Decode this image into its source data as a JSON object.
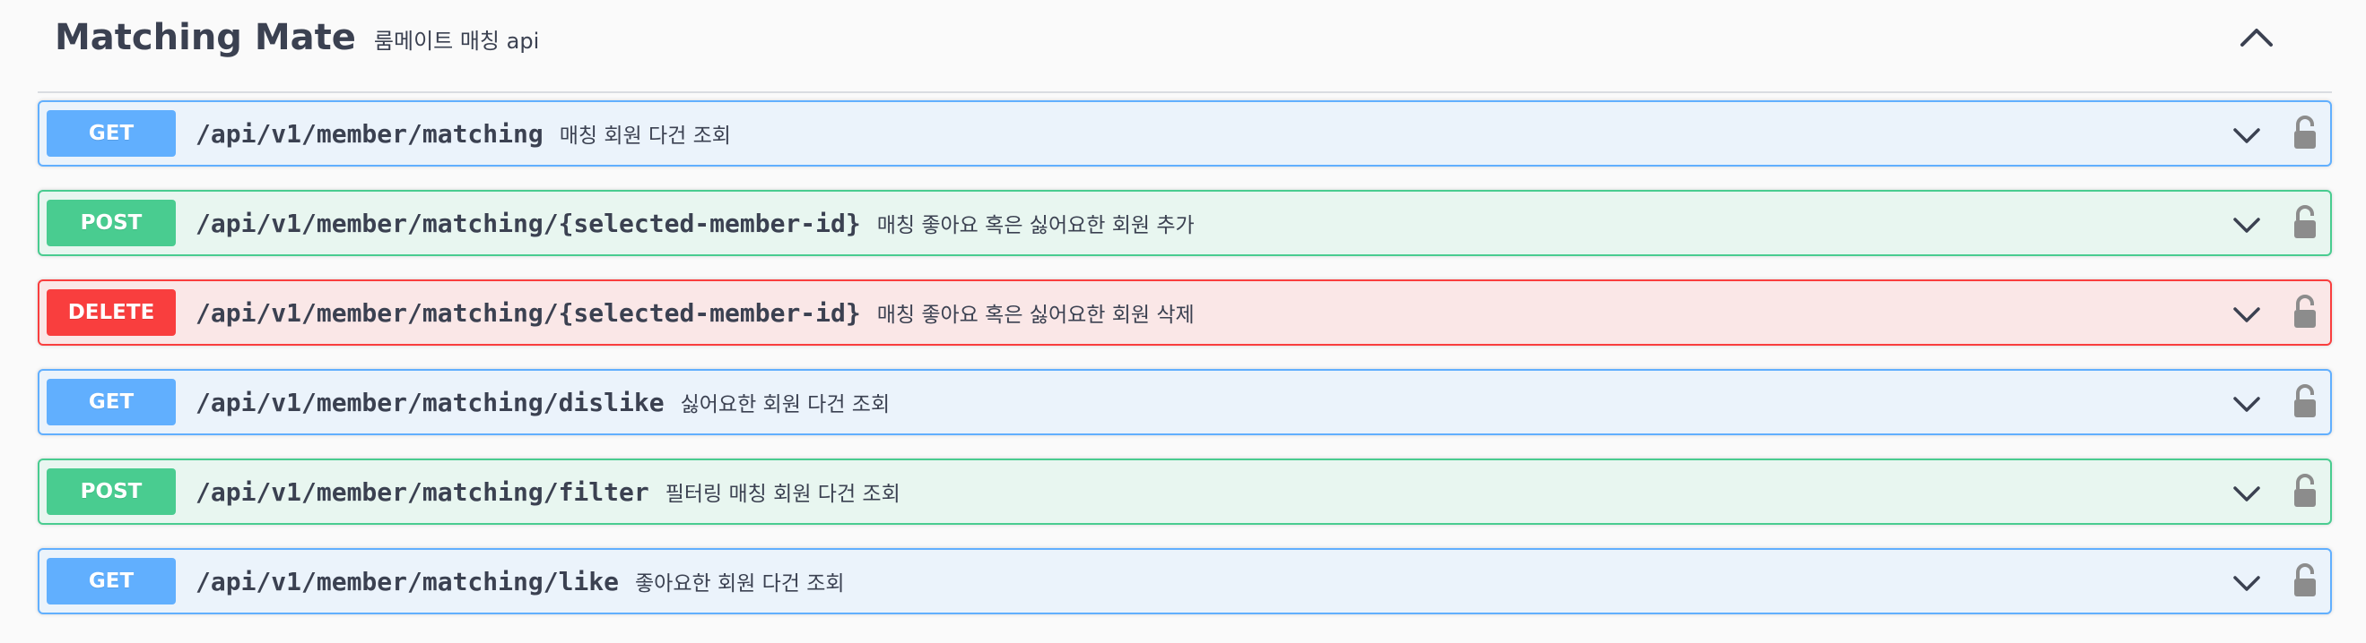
{
  "tag": {
    "name": "Matching Mate",
    "description": "룸메이트 매칭 api"
  },
  "icons": {
    "tag_toggle": "chevron-up-icon",
    "expand": "chevron-down-icon",
    "auth": "lock-icon"
  },
  "colors": {
    "get": "#61affe",
    "post": "#49cc90",
    "delete": "#f93e3e"
  },
  "operations": [
    {
      "method": "GET",
      "path": "/api/v1/member/matching",
      "summary": "매칭 회원 다건 조회"
    },
    {
      "method": "POST",
      "path": "/api/v1/member/matching/{selected-member-id}",
      "summary": "매칭 좋아요 혹은 싫어요한 회원 추가"
    },
    {
      "method": "DELETE",
      "path": "/api/v1/member/matching/{selected-member-id}",
      "summary": "매칭 좋아요 혹은 싫어요한 회원 삭제"
    },
    {
      "method": "GET",
      "path": "/api/v1/member/matching/dislike",
      "summary": "싫어요한 회원 다건 조회"
    },
    {
      "method": "POST",
      "path": "/api/v1/member/matching/filter",
      "summary": "필터링 매칭 회원 다건 조회"
    },
    {
      "method": "GET",
      "path": "/api/v1/member/matching/like",
      "summary": "좋아요한 회원 다건 조회"
    }
  ]
}
